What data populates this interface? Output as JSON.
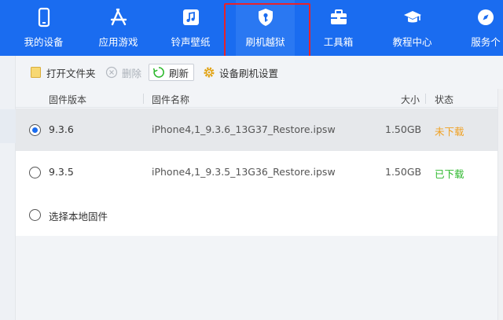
{
  "nav": {
    "items": [
      {
        "label": "我的设备",
        "icon": "phone-icon"
      },
      {
        "label": "应用游戏",
        "icon": "app-store-icon"
      },
      {
        "label": "铃声壁纸",
        "icon": "music-icon"
      },
      {
        "label": "刷机越狱",
        "icon": "shield-key-icon",
        "active": true
      },
      {
        "label": "工具箱",
        "icon": "toolbox-icon"
      },
      {
        "label": "教程中心",
        "icon": "graduation-cap-icon"
      },
      {
        "label": "服务个",
        "icon": "compass-icon"
      }
    ]
  },
  "toolbar": {
    "open_folder": "打开文件夹",
    "delete": "删除",
    "refresh": "刷新",
    "device_settings": "设备刷机设置"
  },
  "table": {
    "headers": {
      "version": "固件版本",
      "name": "固件名称",
      "size": "大小",
      "status": "状态"
    },
    "rows": [
      {
        "version": "9.3.6",
        "name": "iPhone4,1_9.3.6_13G37_Restore.ipsw",
        "size": "1.50GB",
        "status": "未下载",
        "status_color": "#f0a020",
        "checked": true
      },
      {
        "version": "9.3.5",
        "name": "iPhone4,1_9.3.5_13G36_Restore.ipsw",
        "size": "1.50GB",
        "status": "已下载",
        "status_color": "#2db82d",
        "checked": false
      }
    ],
    "local_option": "选择本地固件"
  },
  "colors": {
    "accent": "#1a6cf0",
    "highlight_outline": "#e8232a"
  }
}
